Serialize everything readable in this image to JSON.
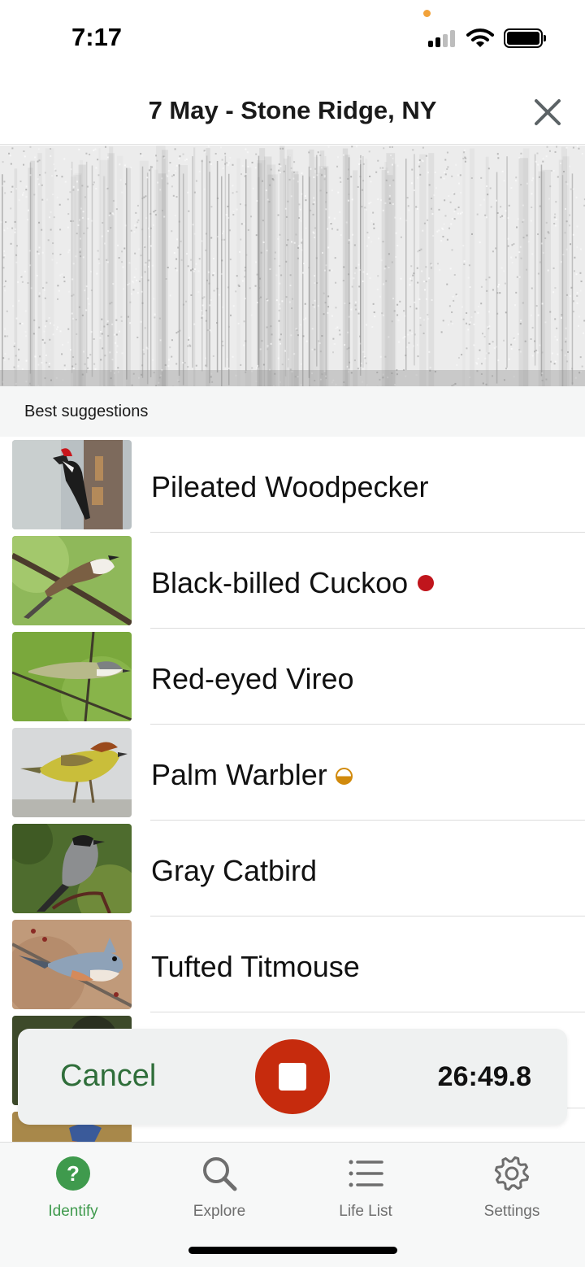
{
  "status_bar": {
    "time": "7:17",
    "icons": [
      "recording-dot",
      "cellular-signal-icon",
      "wifi-icon",
      "battery-icon"
    ]
  },
  "header": {
    "title": "7 May - Stone Ridge, NY",
    "close_icon": "close-icon"
  },
  "section": {
    "label": "Best suggestions"
  },
  "suggestions": [
    {
      "name": "Pileated Woodpecker",
      "badge": ""
    },
    {
      "name": "Black-billed Cuckoo",
      "badge": "rare"
    },
    {
      "name": "Red-eyed Vireo",
      "badge": ""
    },
    {
      "name": "Palm Warbler",
      "badge": "half"
    },
    {
      "name": "Gray Catbird",
      "badge": ""
    },
    {
      "name": "Tufted Titmouse",
      "badge": ""
    }
  ],
  "recording": {
    "cancel_label": "Cancel",
    "stop_icon": "stop-icon",
    "elapsed": "26:49.8"
  },
  "tabs": [
    {
      "label": "Identify",
      "icon": "question-circle-icon",
      "active": true
    },
    {
      "label": "Explore",
      "icon": "search-icon",
      "active": false
    },
    {
      "label": "Life List",
      "icon": "list-icon",
      "active": false
    },
    {
      "label": "Settings",
      "icon": "gear-icon",
      "active": false
    }
  ],
  "colors": {
    "accent_green": "#3f9a4d",
    "cancel_green": "#2f6e3a",
    "stop_red": "#c62b0d",
    "rare_badge": "#c0151c",
    "half_badge": "#d18a0c"
  }
}
